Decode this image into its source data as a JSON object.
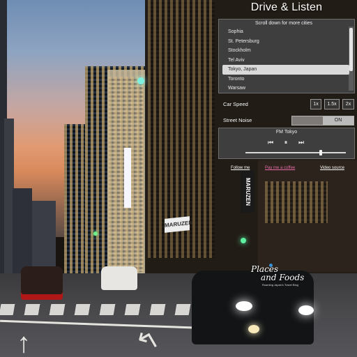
{
  "app": {
    "title": "Drive & Listen"
  },
  "city_selector": {
    "hint": "Scroll down for more cities",
    "cities": [
      "Sophia",
      "St. Petersburg",
      "Stockholm",
      "Tel Aviv",
      "Tokyo, Japan",
      "Toronto",
      "Warsaw"
    ],
    "selected": "Tokyo, Japan"
  },
  "car_speed": {
    "label": "Car Speed",
    "options": [
      "1x",
      "1.5x",
      "2x"
    ]
  },
  "street_noise": {
    "label": "Street Noise",
    "state": "ON"
  },
  "radio": {
    "station": "FM Tokyo",
    "controls": {
      "previous": "previous-icon",
      "pause": "pause-icon",
      "next": "next-icon"
    },
    "volume_level": 0.75
  },
  "links": {
    "follow": "Follow me",
    "pay": "Pay me a coffee",
    "video_source": "Video source"
  },
  "logo": {
    "line1": "Places",
    "line2": "and Foods",
    "tagline": "Roaming Japan's Travel Blog"
  },
  "signs": {
    "store1": "MARUZEN",
    "store2": "MARUZEN"
  },
  "colors": {
    "panel": "#464648",
    "selected_row": "#d9d9d9",
    "pink_link": "#e86aa8",
    "logo_dot": "#3a8fd9"
  }
}
